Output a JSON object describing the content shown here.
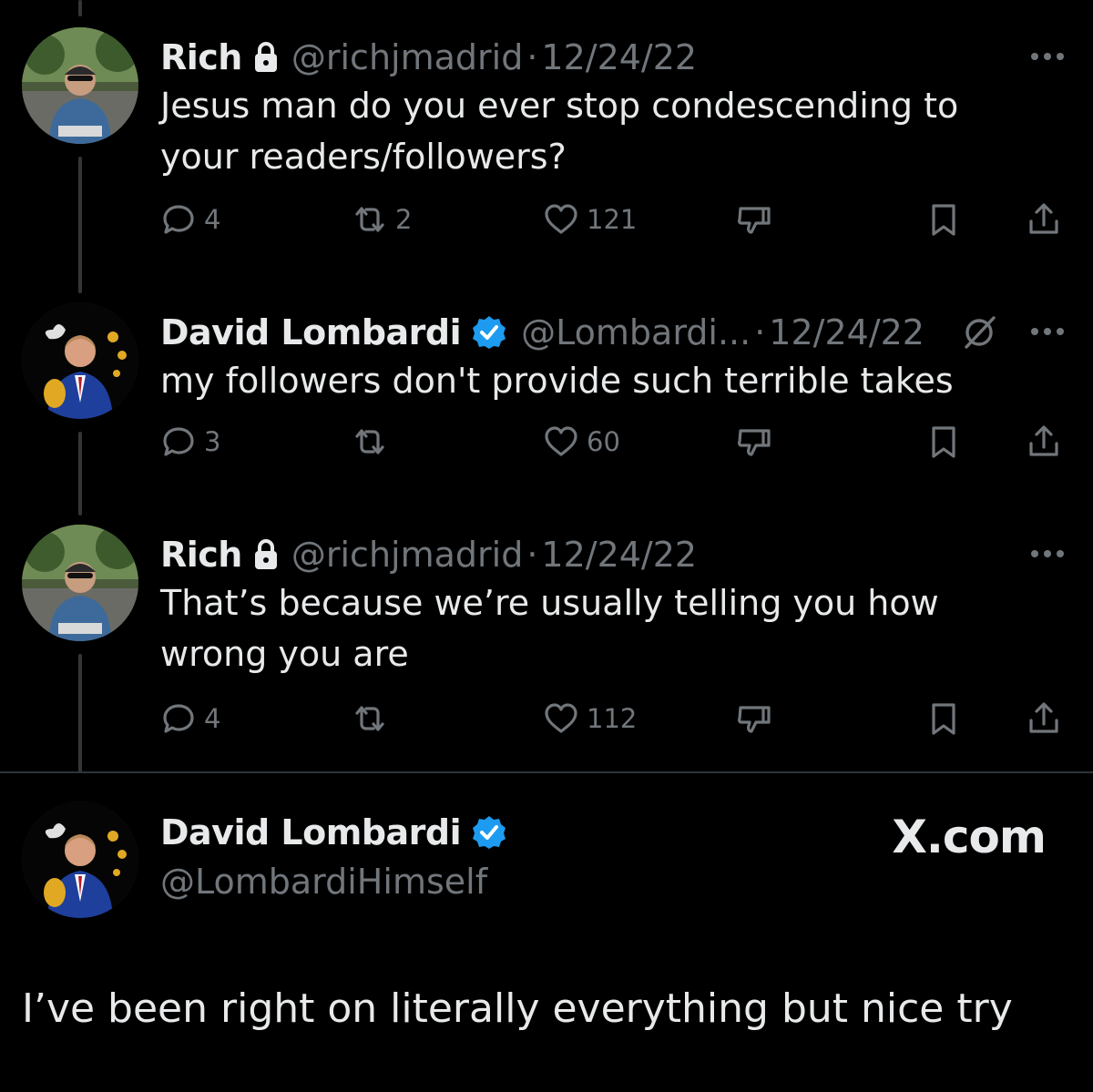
{
  "colors": {
    "background": "#000000",
    "text_primary": "#e7e9ea",
    "text_secondary": "#71767b",
    "verified_blue": "#1d9bf0",
    "thread_line": "#333639"
  },
  "tweets": [
    {
      "name": "Rich",
      "locked": true,
      "handle": "@richjmadrid",
      "separator": "·",
      "date": "12/24/22",
      "text": "Jesus man do you ever stop condescending to your readers/followers?",
      "replies": "4",
      "retweets": "2",
      "likes": "121"
    },
    {
      "name": "David Lombardi",
      "verified": true,
      "handle": "@Lombardi...",
      "separator": "·",
      "date": "12/24/22",
      "text": "my followers don't provide such terrible takes",
      "replies": "3",
      "retweets": "",
      "likes": "60"
    },
    {
      "name": "Rich",
      "locked": true,
      "handle": "@richjmadrid",
      "separator": "·",
      "date": "12/24/22",
      "text": "That’s because we’re usually telling you how wrong you are",
      "replies": "4",
      "retweets": "",
      "likes": "112"
    }
  ],
  "main_tweet": {
    "name": "David Lombardi",
    "handle": "@LombardiHimself",
    "brand": "X.com",
    "text": "I’ve been right on literally everything but nice try"
  }
}
